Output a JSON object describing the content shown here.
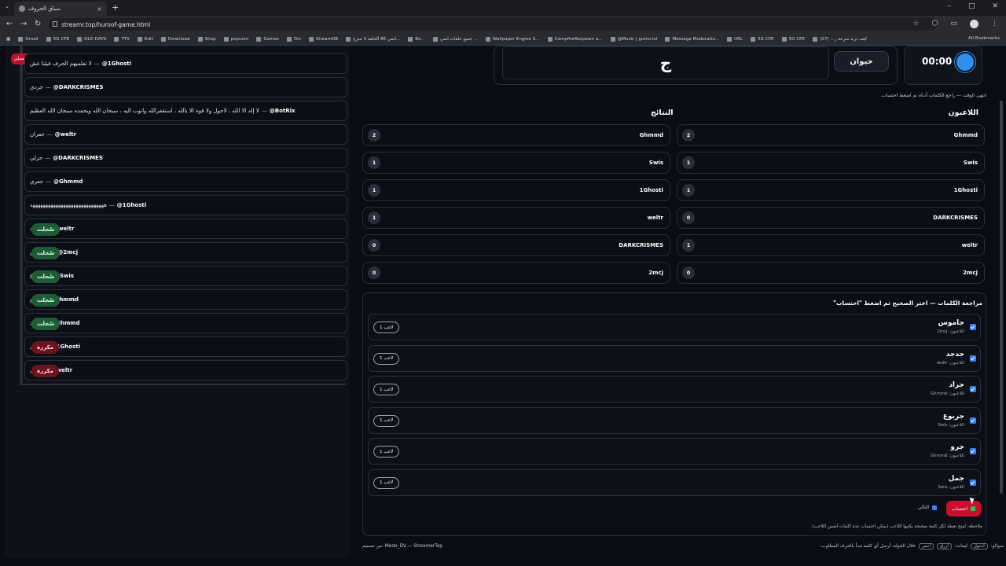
{
  "browser": {
    "tab_title": "سباق الحروف",
    "url": "streamr.top/huroof-game.html",
    "bookmarks": [
      "Gmail",
      "5G CPE",
      "OLD DAYS",
      "TTV",
      "Edit",
      "Download",
      "Shop",
      "popcorn",
      "Games",
      "Dis",
      "StreamDB",
      "انمي 86 الحلقة 3 مترج...",
      "Bo...",
      "جميع حلقات انمي ...",
      "Wallpaper Engine S...",
      "CampfireRespawn a...",
      "@Music | gums.lol",
      "Message Moderatio...",
      "URL",
      "5G CPE",
      "5G CPE",
      "كيف تزيد سرعة ر... (27)"
    ],
    "all_bookmarks": "All Bookmarks"
  },
  "left": {
    "explain_button": "شرح تفصيلي",
    "messages": [
      {
        "user": "@1Ghosti",
        "text": "لا تعلميهم الحرف فيئنا غش",
        "badge": ""
      },
      {
        "user": "@DARKCRISMES",
        "text": "جردي",
        "badge": ""
      },
      {
        "user": "@BotRix",
        "text": "لا إله الا الله ، لاحول ولا قوة الا بالله ، استغفرالله واتوب اليه ، سبحان الله وبحمده سبحان الله العظيم",
        "badge": ""
      },
      {
        "user": "@weltr",
        "text": "جعران",
        "badge": ""
      },
      {
        "user": "@DARKCRISMES",
        "text": "جزلي",
        "badge": ""
      },
      {
        "user": "@Ghmmd",
        "text": "جعري",
        "badge": ""
      },
      {
        "user": "@1Ghosti",
        "text": "هههههههههههههههههههههههههههههه",
        "badge": ""
      },
      {
        "user": "@weltr",
        "text": "جدجد",
        "badge": "ok"
      },
      {
        "user": "@2mcj",
        "text": "جاموس",
        "badge": "ok"
      },
      {
        "user": "@Swis",
        "text": "جربوع",
        "badge": "ok"
      },
      {
        "user": "@Ghmmd",
        "text": "جرو",
        "badge": "ok"
      },
      {
        "user": "@Ghmmd",
        "text": "جراد",
        "badge": "ok"
      },
      {
        "user": "@1Ghosti",
        "text": "جمل",
        "badge": "dup"
      },
      {
        "user": "@weltr",
        "text": "جمل",
        "badge": "dup"
      }
    ],
    "badge_ok": "سُجلت",
    "badge_dup": "مكررة",
    "sep": "—"
  },
  "game": {
    "timer": "00:00",
    "letter": "ج",
    "category": "حيوان",
    "time_message": "انتهى الوقت — راجع الكلمات أدناه ثم اضغط احتساب."
  },
  "players_title": "اللاعبون",
  "results_title": "النتائج",
  "players": [
    {
      "name": "Ghmmd",
      "points": "2"
    },
    {
      "name": "Swis",
      "points": "1"
    },
    {
      "name": "1Ghosti",
      "points": "1"
    },
    {
      "name": "DARKCRISMES",
      "points": "0"
    },
    {
      "name": "weltr",
      "points": "1"
    },
    {
      "name": "2mcj",
      "points": "0"
    }
  ],
  "results": [
    {
      "name": "Ghmmd",
      "points": "2"
    },
    {
      "name": "Swis",
      "points": "1"
    },
    {
      "name": "1Ghosti",
      "points": "1"
    },
    {
      "name": "weltr",
      "points": "1"
    },
    {
      "name": "DARKCRISMES",
      "points": "0"
    },
    {
      "name": "2mcj",
      "points": "0"
    }
  ],
  "review": {
    "title": "مراجعة الكلمات — اختر الصحيح ثم اضغط \"احتساب\"",
    "words": [
      {
        "word": "جاموس",
        "players": "اللاعبون: 2mcj",
        "count": "1 لاعب"
      },
      {
        "word": "جدجد",
        "players": "اللاعبون: weltr",
        "count": "1 لاعب"
      },
      {
        "word": "جراد",
        "players": "اللاعبون: Ghmmd",
        "count": "1 لاعب"
      },
      {
        "word": "جربوع",
        "players": "اللاعبون: Swis",
        "count": "1 لاعب"
      },
      {
        "word": "جرو",
        "players": "اللاعبون: Ghmmd",
        "count": "1 لاعب"
      },
      {
        "word": "جمل",
        "players": "اللاعبون: Swis",
        "count": "1 لاعب"
      }
    ],
    "calc_button": "احتساب",
    "next_button": "التالي",
    "note": "ملاحظة: تُمنح نقطة لكل كلمة صحيحة يكتبها اللاعب (يمكن احتساب عدة كلمات لنفس اللاعب)."
  },
  "footer": {
    "credit": "من تصميم: Medo_DV — StreamerTop",
    "howto": "سوالو:",
    "howto_rest": "خلال الجولة، أرسل أي كلمة تبدأ بالحرف المطلوب.",
    "kbd1": "ادخول",
    "kbd2": "ازرق",
    "kbd3": "احمر",
    "teams": "ليمات:"
  }
}
